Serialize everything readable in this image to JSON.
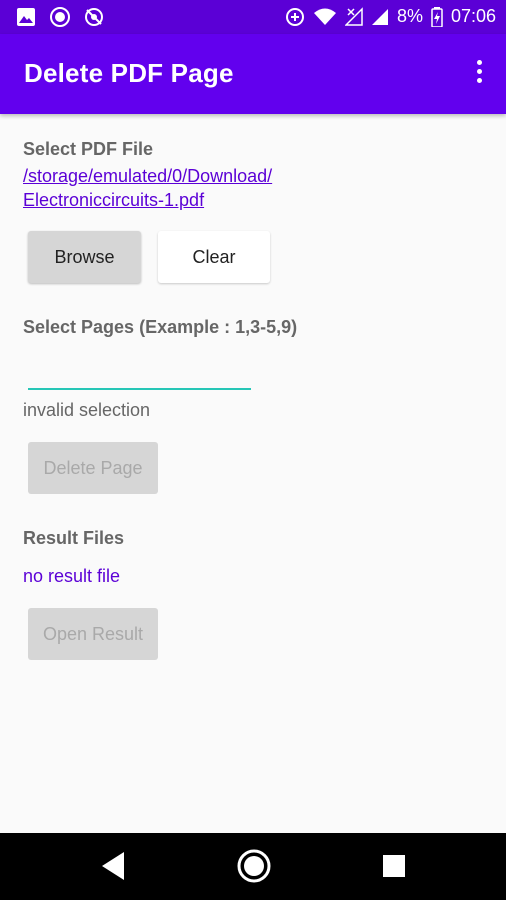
{
  "status_bar": {
    "battery": "8%",
    "time": "07:06"
  },
  "app_bar": {
    "title": "Delete PDF Page"
  },
  "select_file": {
    "label": "Select PDF File",
    "path_line1": "/storage/emulated/0/Download/",
    "path_line2": "Electroniccircuits-1.pdf",
    "browse_label": "Browse",
    "clear_label": "Clear"
  },
  "select_pages": {
    "label": "Select Pages (Example : 1,3-5,9)",
    "input_value": "",
    "validation_text": "invalid selection",
    "delete_label": "Delete Page"
  },
  "results": {
    "label": "Result Files",
    "status": "no result file",
    "open_label": "Open Result"
  },
  "colors": {
    "app_bar": "#6200ee",
    "status_bar": "#5b00d6",
    "accent": "#26c6b6",
    "link": "#5b00d6"
  }
}
